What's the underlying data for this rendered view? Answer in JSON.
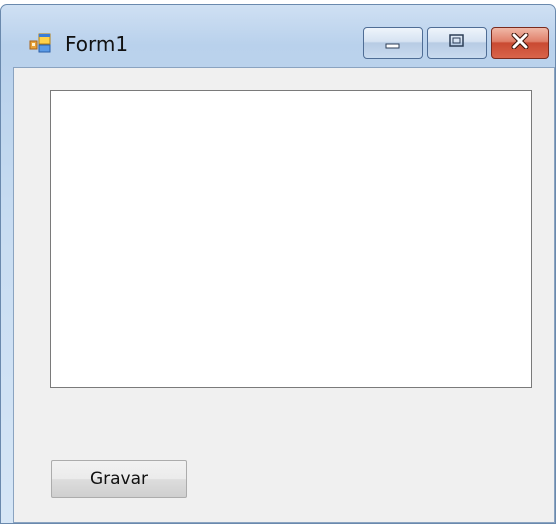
{
  "window": {
    "title": "Form1"
  },
  "controls": {
    "text_box_value": "",
    "button_label": "Gravar"
  },
  "icons": {
    "app": "form-app-icon",
    "minimize": "minimize-icon",
    "maximize": "maximize-icon",
    "close": "close-icon"
  },
  "colors": {
    "close_button": "#c94a32",
    "client_background": "#f0f0f0"
  }
}
